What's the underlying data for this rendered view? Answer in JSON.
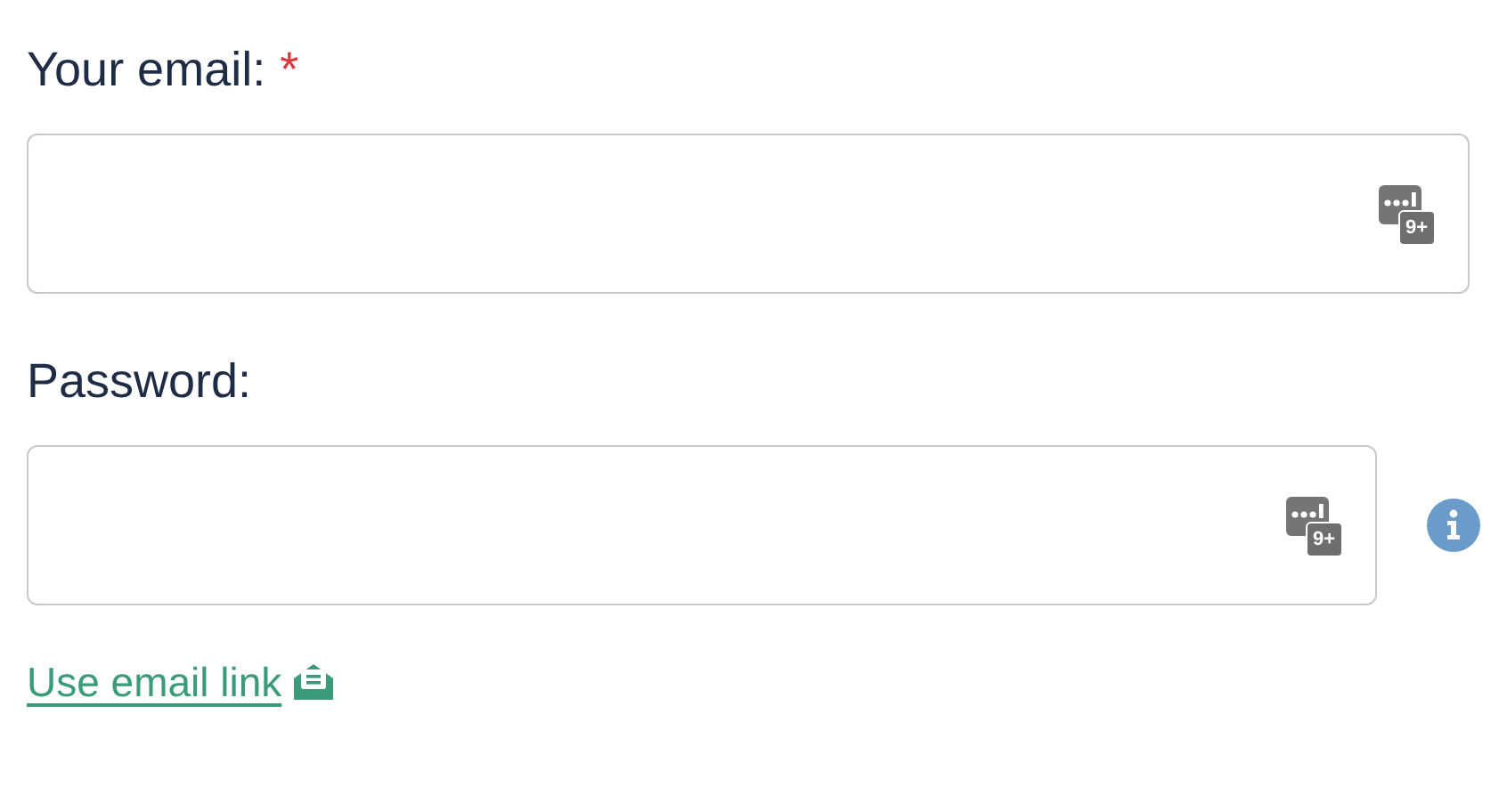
{
  "fields": [
    {
      "label": "Your email:",
      "required_mark": "*",
      "badge": "9+",
      "info": false
    },
    {
      "label": "Password:",
      "badge": "9+",
      "info": true
    }
  ],
  "link": {
    "label": "Use email link"
  }
}
